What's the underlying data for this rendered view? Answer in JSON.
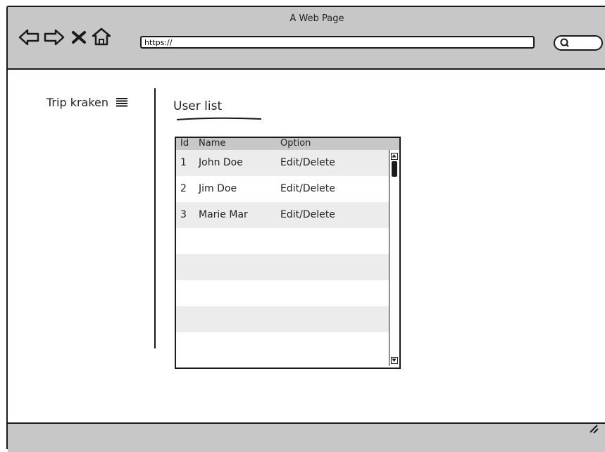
{
  "window": {
    "title": "A Web Page",
    "address": "https://"
  },
  "icons": {
    "back": "back-arrow-icon",
    "forward": "forward-arrow-icon",
    "stop": "close-icon",
    "home": "home-icon",
    "search": "search-icon",
    "hamburger": "hamburger-menu-icon",
    "resize": "resize-grip-icon"
  },
  "sidebar": {
    "brand": "Trip kraken"
  },
  "main": {
    "title": "User list",
    "table": {
      "columns": [
        "Id",
        "Name",
        "Option"
      ],
      "rows": [
        {
          "id": "1",
          "name": "John Doe",
          "option": "Edit/Delete"
        },
        {
          "id": "2",
          "name": "Jim Doe",
          "option": "Edit/Delete"
        },
        {
          "id": "3",
          "name": "Marie Mar",
          "option": "Edit/Delete"
        },
        {
          "id": "",
          "name": "",
          "option": ""
        },
        {
          "id": "",
          "name": "",
          "option": ""
        },
        {
          "id": "",
          "name": "",
          "option": ""
        },
        {
          "id": "",
          "name": "",
          "option": ""
        },
        {
          "id": "",
          "name": "",
          "option": ""
        }
      ]
    }
  },
  "colors": {
    "chrome": "#c7c7c7",
    "stroke": "#1a1a1a",
    "row_alt": "#ececec"
  }
}
